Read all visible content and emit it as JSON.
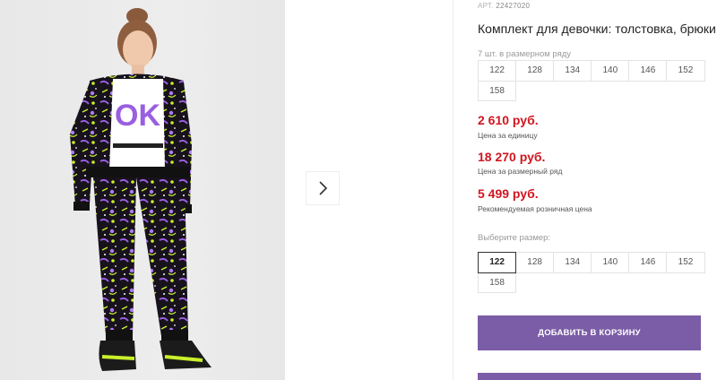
{
  "product": {
    "sku_label": "АРТ.",
    "sku_value": "22427020",
    "title": "Комплект для девочки: толстовка, брюки"
  },
  "size_range": {
    "label": "7 шт. в размерном ряду",
    "sizes": [
      "122",
      "128",
      "134",
      "140",
      "146",
      "152",
      "158"
    ]
  },
  "prices": [
    {
      "value": "2 610 руб.",
      "note": "Цена за единицу"
    },
    {
      "value": "18 270 руб.",
      "note": "Цена за размерный ряд"
    },
    {
      "value": "5 499 руб.",
      "note": "Рекомендуемая розничная цена"
    }
  ],
  "size_select": {
    "label": "Выберите размер:",
    "sizes": [
      "122",
      "128",
      "134",
      "140",
      "146",
      "152",
      "158"
    ],
    "selected": "122"
  },
  "actions": {
    "add_to_cart": "ДОБАВИТЬ В КОРЗИНУ"
  },
  "colors": {
    "accent": "#7b5ca6",
    "price": "#d0161f"
  },
  "icons": {
    "next": "chevron-right-icon"
  }
}
